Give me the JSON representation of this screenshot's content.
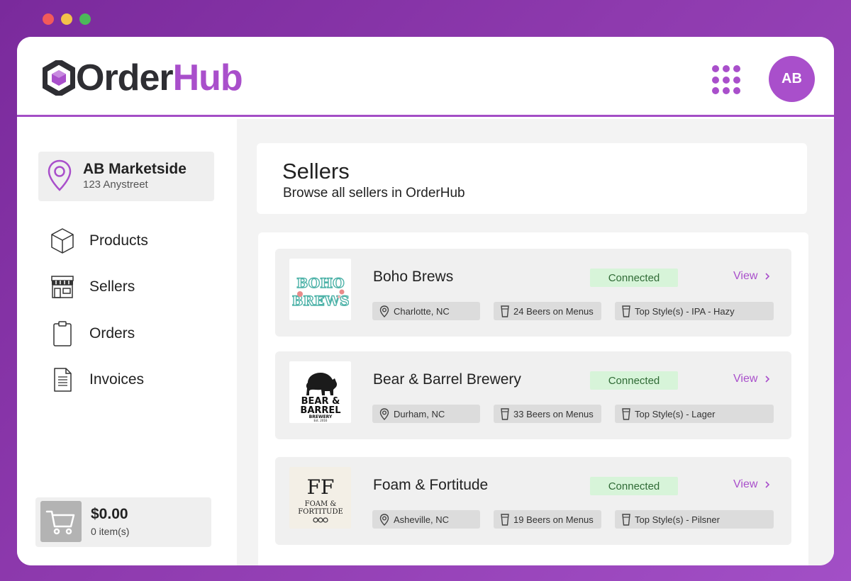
{
  "app": {
    "logo_part1": "Order",
    "logo_part2": "Hub",
    "user_initials": "AB"
  },
  "colors": {
    "accent": "#a94fcb",
    "dark": "#2e2e33",
    "connected_bg": "#d7f4d9",
    "connected_text": "#2f6a35"
  },
  "sidebar": {
    "location": {
      "name": "AB Marketside",
      "address": "123 Anystreet",
      "icon": "map-pin-icon"
    },
    "items": [
      {
        "label": "Products",
        "icon": "cube-icon"
      },
      {
        "label": "Sellers",
        "icon": "storefront-icon"
      },
      {
        "label": "Orders",
        "icon": "clipboard-icon"
      },
      {
        "label": "Invoices",
        "icon": "document-icon"
      }
    ],
    "cart": {
      "amount": "$0.00",
      "items": "0 item(s)",
      "icon": "cart-icon"
    }
  },
  "main": {
    "title": "Sellers",
    "subtitle": "Browse all sellers in OrderHub",
    "sellers": [
      {
        "name": "Boho Brews",
        "status": "Connected",
        "view_label": "View",
        "location": "Charlotte, NC",
        "beers": "24 Beers on Menus",
        "style": "Top Style(s) - IPA - Hazy",
        "logo_text_1": "BOHO",
        "logo_text_2": "BREWS"
      },
      {
        "name": "Bear & Barrel Brewery",
        "status": "Connected",
        "view_label": "View",
        "location": "Durham, NC",
        "beers": "33 Beers on Menus",
        "style": "Top Style(s) - Lager",
        "logo_text_1": "BEAR &",
        "logo_text_2": "BARREL",
        "logo_text_3": "BREWERY",
        "logo_text_4": "Est. 2016"
      },
      {
        "name": "Foam & Fortitude",
        "status": "Connected",
        "view_label": "View",
        "location": "Asheville, NC",
        "beers": "19 Beers on Menus",
        "style": "Top Style(s) - Pilsner",
        "logo_text_1": "FF",
        "logo_text_2": "FOAM &",
        "logo_text_3": "FORTITUDE"
      }
    ]
  }
}
